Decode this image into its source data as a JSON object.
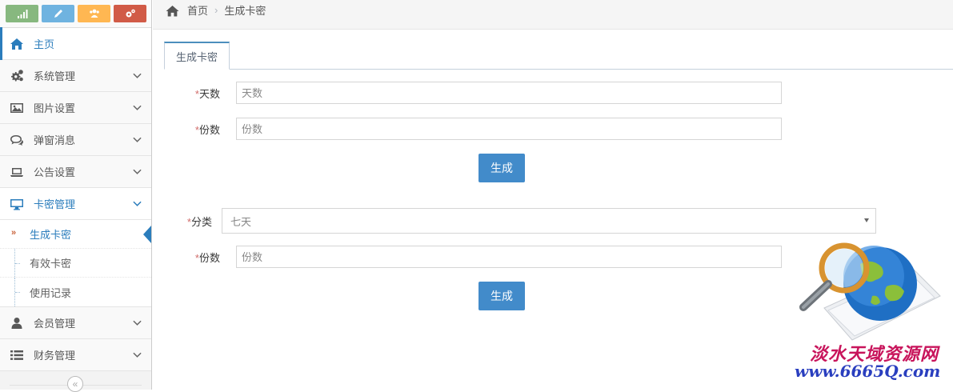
{
  "sidebar": {
    "shortcuts": [
      {
        "icon": "signal-icon",
        "color": "#87b87f"
      },
      {
        "icon": "pencil-icon",
        "color": "#6fb3e0"
      },
      {
        "icon": "users-icon",
        "color": "#ffb752"
      },
      {
        "icon": "cogs-icon",
        "color": "#d15b47"
      }
    ],
    "items": [
      {
        "label": "主页",
        "icon": "home-icon"
      },
      {
        "label": "系统管理",
        "icon": "cogs-icon"
      },
      {
        "label": "图片设置",
        "icon": "picture-icon"
      },
      {
        "label": "弹窗消息",
        "icon": "comments-icon"
      },
      {
        "label": "公告设置",
        "icon": "laptop-icon"
      },
      {
        "label": "卡密管理",
        "icon": "desktop-icon"
      },
      {
        "label": "会员管理",
        "icon": "user-icon"
      },
      {
        "label": "财务管理",
        "icon": "list-icon"
      }
    ],
    "submenu": [
      {
        "label": "生成卡密"
      },
      {
        "label": "有效卡密"
      },
      {
        "label": "使用记录"
      }
    ],
    "collapse_icon": "«"
  },
  "breadcrumb": {
    "home": "首页",
    "separator": "›",
    "current": "生成卡密"
  },
  "tab": {
    "label": "生成卡密"
  },
  "form1": {
    "days_label": "天数",
    "days_placeholder": "天数",
    "count_label": "份数",
    "count_placeholder": "份数",
    "submit_label": "生成",
    "required_mark": "*"
  },
  "form2": {
    "category_label": "分类",
    "category_value": "七天",
    "count_label": "份数",
    "count_placeholder": "份数",
    "submit_label": "生成",
    "required_mark": "*"
  },
  "watermark": {
    "line1": "淡水天域资源网",
    "line2": "www.6665Q.com"
  },
  "colors": {
    "accent": "#2b7dbc",
    "button": "#428bca",
    "required": "#d16e6c"
  }
}
